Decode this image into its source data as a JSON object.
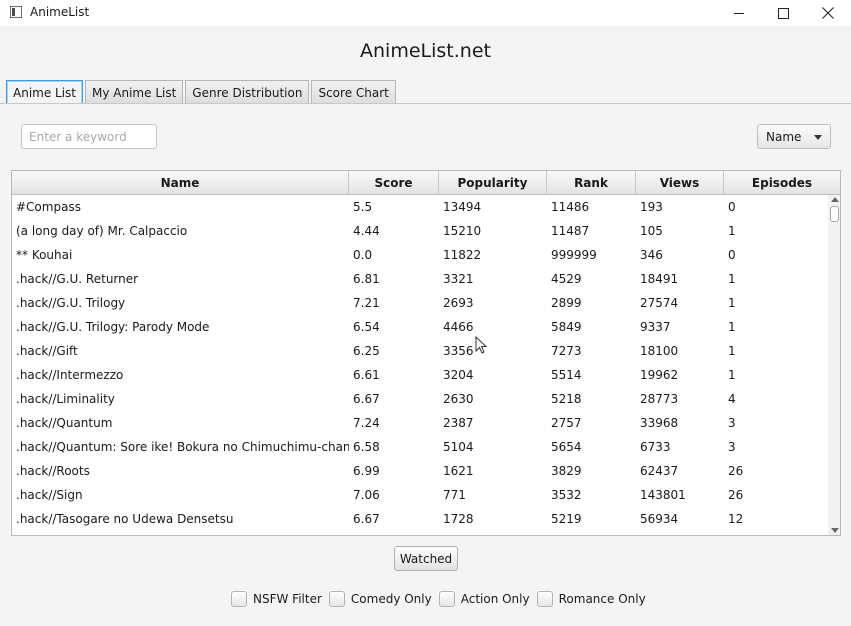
{
  "window": {
    "title": "AnimeList"
  },
  "header": {
    "title": "AnimeList.net"
  },
  "tabs": [
    {
      "label": "Anime List",
      "active": true
    },
    {
      "label": "My Anime List",
      "active": false
    },
    {
      "label": "Genre Distribution",
      "active": false
    },
    {
      "label": "Score Chart",
      "active": false
    }
  ],
  "search": {
    "placeholder": "Enter a keyword",
    "value": ""
  },
  "sort": {
    "selected": "Name"
  },
  "table": {
    "columns": [
      "Name",
      "Score",
      "Popularity",
      "Rank",
      "Views",
      "Episodes"
    ],
    "rows": [
      [
        "#Compass",
        "5.5",
        "13494",
        "11486",
        "193",
        "0"
      ],
      [
        "(a long day of) Mr. Calpaccio",
        "4.44",
        "15210",
        "11487",
        "105",
        "1"
      ],
      [
        "** Kouhai",
        "0.0",
        "11822",
        "999999",
        "346",
        "0"
      ],
      [
        ".hack//G.U. Returner",
        "6.81",
        "3321",
        "4529",
        "18491",
        "1"
      ],
      [
        ".hack//G.U. Trilogy",
        "7.21",
        "2693",
        "2899",
        "27574",
        "1"
      ],
      [
        ".hack//G.U. Trilogy: Parody Mode",
        "6.54",
        "4466",
        "5849",
        "9337",
        "1"
      ],
      [
        ".hack//Gift",
        "6.25",
        "3356",
        "7273",
        "18100",
        "1"
      ],
      [
        ".hack//Intermezzo",
        "6.61",
        "3204",
        "5514",
        "19962",
        "1"
      ],
      [
        ".hack//Liminality",
        "6.67",
        "2630",
        "5218",
        "28773",
        "4"
      ],
      [
        ".hack//Quantum",
        "7.24",
        "2387",
        "2757",
        "33968",
        "3"
      ],
      [
        ".hack//Quantum: Sore ike! Bokura no Chimuchimu-chan!!",
        "6.58",
        "5104",
        "5654",
        "6733",
        "3"
      ],
      [
        ".hack//Roots",
        "6.99",
        "1621",
        "3829",
        "62437",
        "26"
      ],
      [
        ".hack//Sign",
        "7.06",
        "771",
        "3532",
        "143801",
        "26"
      ],
      [
        ".hack//Tasogare no Udewa Densetsu",
        "6.67",
        "1728",
        "5219",
        "56934",
        "12"
      ]
    ]
  },
  "actions": {
    "watched_label": "Watched"
  },
  "filters": [
    {
      "label": "NSFW Filter",
      "checked": false
    },
    {
      "label": "Comedy Only",
      "checked": false
    },
    {
      "label": "Action Only",
      "checked": false
    },
    {
      "label": "Romance Only",
      "checked": false
    }
  ]
}
